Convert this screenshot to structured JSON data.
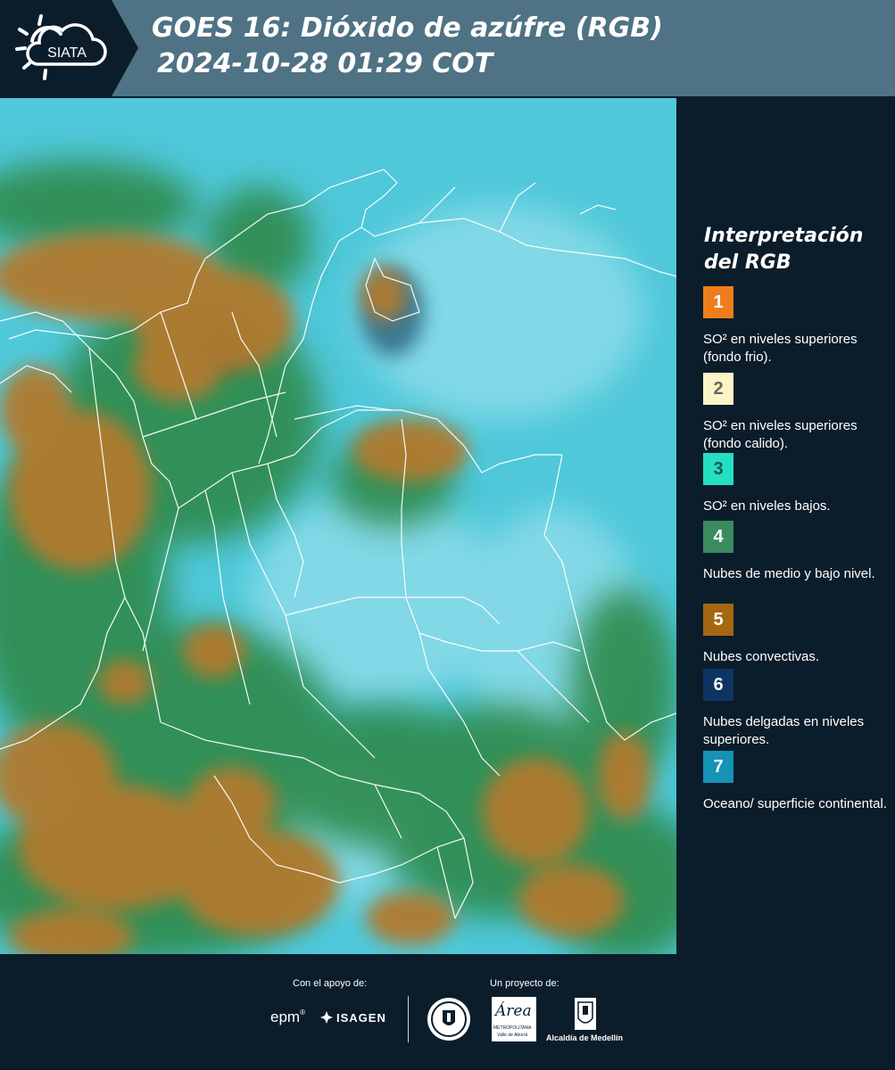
{
  "header": {
    "logo_text": "SIATA",
    "title_line1": "GOES 16: Dióxido de azúfre (RGB)",
    "title_line2": "2024-10-28 01:29 COT"
  },
  "map": {
    "colors": {
      "cyan": "#3fc6d9",
      "green": "#2f8a4c",
      "orange": "#b17a2f",
      "border": "#ffffff"
    }
  },
  "legend": {
    "title_line1": "Interpretación",
    "title_line2": "del RGB",
    "items": [
      {
        "number": "1",
        "color": "#f07d1c",
        "label": "SO² en niveles superiores (fondo frio)."
      },
      {
        "number": "2",
        "color": "#fbf4c6",
        "label": "SO² en niveles superiores (fondo calido)."
      },
      {
        "number": "3",
        "color": "#25dfc3",
        "label": "SO² en niveles bajos."
      },
      {
        "number": "4",
        "color": "#3b8b5f",
        "label": "Nubes de medio y bajo nivel."
      },
      {
        "number": "5",
        "color": "#a66713",
        "label": "Nubes convectivas."
      },
      {
        "number": "6",
        "color": "#0e3463",
        "label": "Nubes delgadas en niveles superiores."
      },
      {
        "number": "7",
        "color": "#1592b6",
        "label": "Oceano/ superficie continental."
      }
    ]
  },
  "footer": {
    "support_caption": "Con el apoyo de:",
    "project_caption": "Un proyecto de:",
    "epm_text": "epm",
    "isagen_text": "ISAGEN",
    "area_text": "Área",
    "area_subtext": "METROPOLITANA",
    "area_subtext2": "Valle de Aburrá",
    "alcaldia_text": "Alcaldía de Medellín"
  }
}
